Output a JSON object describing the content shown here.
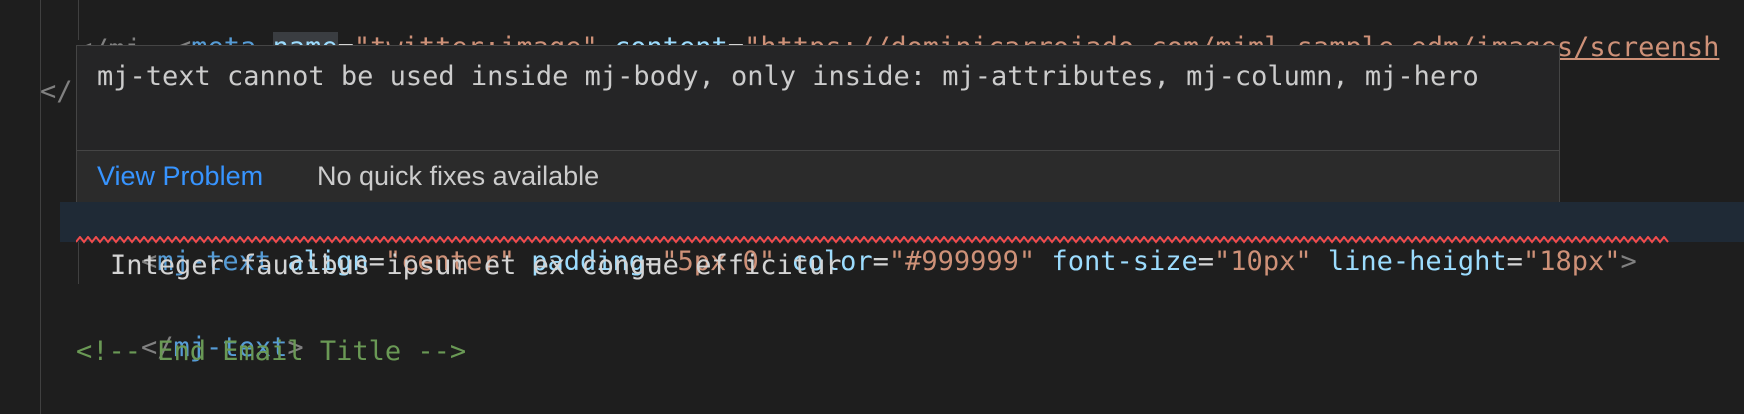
{
  "colors": {
    "background": "#1e1e1e",
    "tag": "#569cd6",
    "attribute": "#9cdcfe",
    "string": "#ce9178",
    "comment": "#6a9955",
    "link": "#3794ff",
    "error_squiggle": "#f14c4c"
  },
  "code": {
    "line_meta": {
      "open": "<",
      "tag": "meta",
      "attr1": "name",
      "eq1": "=",
      "val1": "\"twitter:image\"",
      "attr2": "content",
      "eq2": "=",
      "val2": "\"https://dominicarrojado.com/mjml-sample-edm/images/screensh"
    },
    "line_partial_close": "</mj",
    "line_close_frag": "</",
    "line_open_frag": "<m",
    "line_mjtext_open": {
      "open": "<",
      "tag": "mj-text",
      "attr1": "align",
      "eq1": "=",
      "val1": "\"center\"",
      "attr2": "padding",
      "eq2": "=",
      "val2": "\"5px 0\"",
      "attr3": "color",
      "eq3": "=",
      "val3": "\"#999999\"",
      "attr4": "font-size",
      "eq4": "=",
      "val4": "\"10px\"",
      "attr5": "line-height",
      "eq5": "=",
      "val5": "\"18px\"",
      "close": ">"
    },
    "line_text": "Integer faucibus ipsum et ex congue efficitur",
    "line_mjtext_close": {
      "open": "</",
      "tag": "mj-text",
      "close": ">"
    },
    "line_comment": "<!-- End Email Title -->"
  },
  "hover": {
    "message": "mj-text cannot be used inside mj-body, only inside: mj-attributes, mj-column, mj-hero",
    "view_problem": "View Problem",
    "no_quick_fixes": "No quick fixes available"
  }
}
